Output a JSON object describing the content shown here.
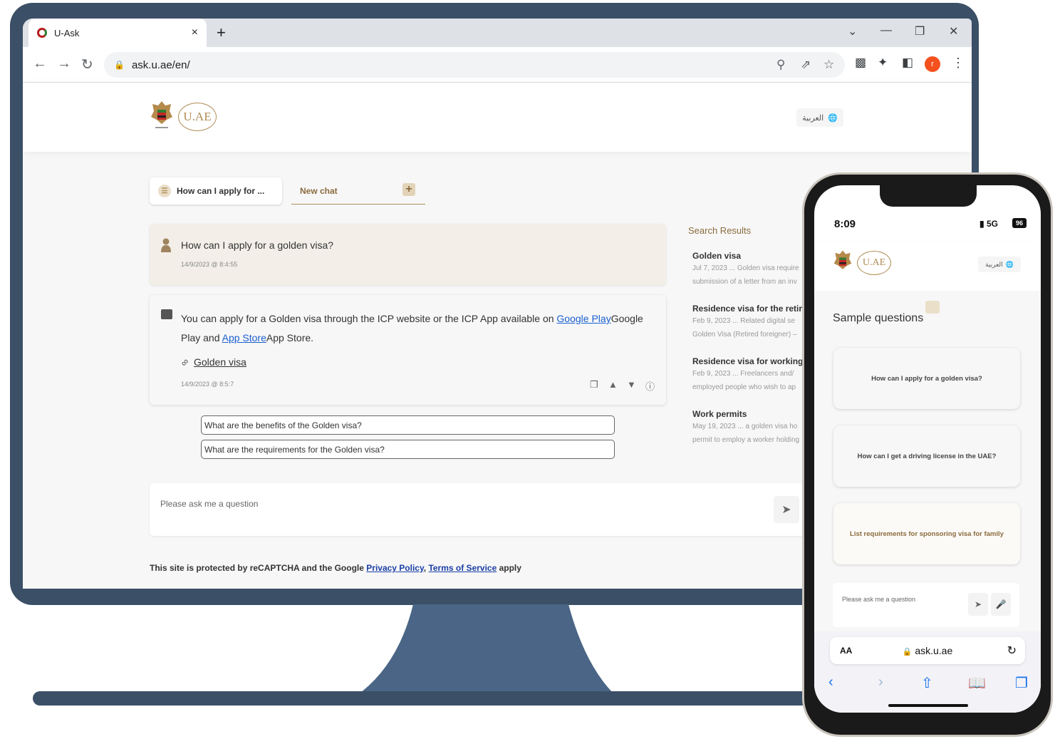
{
  "browser": {
    "tab_title": "U-Ask",
    "tab_close": "×",
    "new_tab": "+",
    "window_controls": {
      "collapse": "⌄",
      "minimize": "—",
      "restore": "❐",
      "close": "✕"
    },
    "url": "ask.u.ae/en/",
    "icons": {
      "back": "arrow-left-icon",
      "forward": "arrow-right-icon",
      "reload": "reload-icon",
      "lock": "lock-icon",
      "zoom": "zoom-icon",
      "share": "share-icon",
      "bookmark": "star-icon",
      "extensions": "puzzle-icon",
      "sidepanel": "sidepanel-icon",
      "menu": "menu-dots-icon"
    },
    "profile_initial": "r"
  },
  "site": {
    "logo_text": "U.AE",
    "lang_label": "العربية",
    "chat_tabs": {
      "previous": "How can I apply for ...",
      "new_chat": "New chat"
    },
    "user_message": {
      "text": "How can I apply for a golden visa?",
      "timestamp": "14/9/2023 @ 8:4:55"
    },
    "bot_message": {
      "text_1": "You can apply for a Golden visa through the ICP website or the ICP App available on ",
      "link_1": "Google Play",
      "text_2": "Google Play and ",
      "link_2": "App Store",
      "text_3": "App Store.",
      "source": "Golden visa",
      "timestamp": "14/9/2023 @ 8:5:7"
    },
    "suggestions": [
      "What are the benefits of the Golden visa?",
      "What are the requirements for the Golden visa?"
    ],
    "search_results": {
      "heading": "Search Results",
      "items": [
        {
          "title": "Golden visa",
          "line1": "Jul 7, 2023 ... Golden visa require",
          "line2": "submission of a letter from an inv"
        },
        {
          "title": "Residence visa for the retire",
          "line1": "Feb 9, 2023 ... Related digital se",
          "line2": "Golden Visa (Retired foreigner) –"
        },
        {
          "title": "Residence visa for working i",
          "line1": "Feb 9, 2023 ... Freelancers and/",
          "line2": "employed people who wish to ap"
        },
        {
          "title": "Work permits",
          "line1": "May 19, 2023 ... a golden visa ho",
          "line2": "permit to employ a worker holding"
        }
      ]
    },
    "ask_placeholder": "Please ask me a question",
    "recaptcha": {
      "prefix": "This site is protected by reCAPTCHA and the Google ",
      "privacy": "Privacy Policy",
      "sep": ", ",
      "terms": "Terms of Service",
      "suffix": " apply"
    }
  },
  "phone": {
    "time": "8:09",
    "signal": "5G",
    "battery": "96",
    "lang_label": "العربية",
    "sample_title": "Sample questions",
    "sample_questions": [
      "How can I apply for a golden visa?",
      "How can I get a driving license in the UAE?",
      "List requirements for sponsoring visa for family"
    ],
    "ask_placeholder": "Please ask me a question",
    "urlbar": {
      "aa": "AA",
      "url": "ask.u.ae"
    }
  },
  "colors": {
    "gold": "#b08d57",
    "monitor": "#3b4f66",
    "link": "#1a5fd1"
  }
}
